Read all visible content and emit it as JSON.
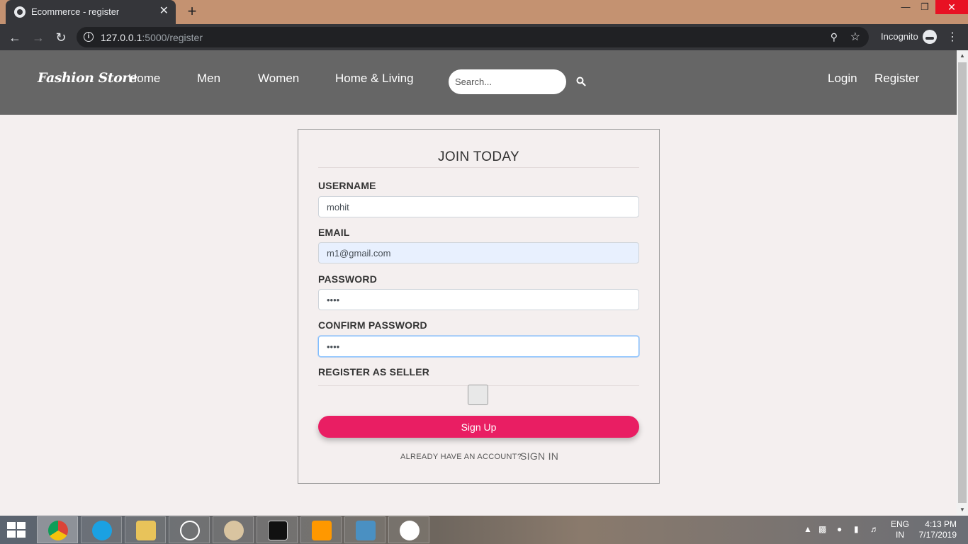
{
  "browser": {
    "tab_title": "Ecommerce - register",
    "tab_close": "✕",
    "new_tab": "+",
    "url_host": "127.0.0.1",
    "url_path": ":5000/register",
    "profile_label": "Incognito"
  },
  "navbar": {
    "brand": "Fashion Store",
    "links": [
      "Home",
      "Men",
      "Women",
      "Home & Living"
    ],
    "search_placeholder": "Search...",
    "login": "Login",
    "register": "Register"
  },
  "form": {
    "title": "JOIN TODAY",
    "username_label": "USERNAME",
    "username_value": "mohit",
    "email_label": "EMAIL",
    "email_value": "m1@gmail.com",
    "password_label": "PASSWORD",
    "password_value": "••••",
    "confirm_label": "CONFIRM PASSWORD",
    "confirm_value": "••••",
    "seller_label": "REGISTER AS SELLER",
    "signup_button": "Sign Up",
    "already_text": "ALREADY HAVE AN ACCOUNT?",
    "signin_link": "SIGN IN"
  },
  "taskbar": {
    "lang_line1": "ENG",
    "lang_line2": "IN",
    "time": "4:13 PM",
    "date": "7/17/2019"
  },
  "colors": {
    "navbar_bg": "#666666",
    "page_bg": "#f4efef",
    "accent": "#e91e63",
    "tabstrip": "#c49271"
  }
}
